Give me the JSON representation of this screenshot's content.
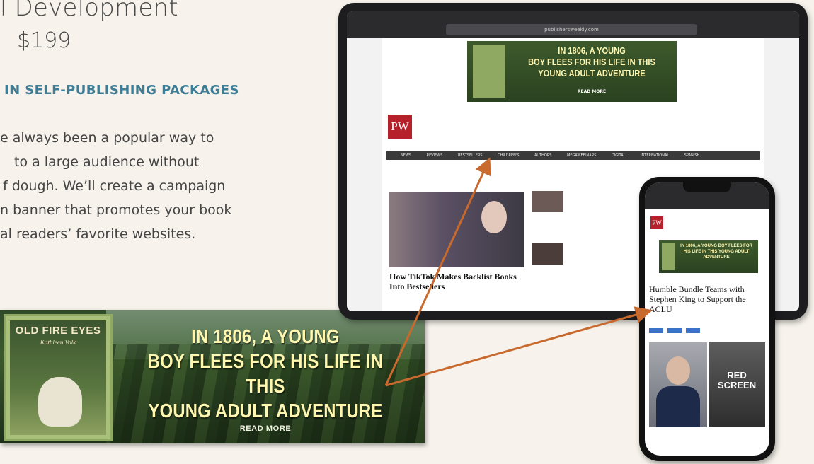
{
  "hero": {
    "title": "l Development",
    "price": "$199",
    "subhead": "IN SELF-PUBLISHING PACKAGES",
    "body_lines": [
      "e always been a popular way to",
      "to a large audience without",
      "f dough. We’ll create a campaign",
      "n banner that promotes your book",
      "al readers’ favorite websites."
    ]
  },
  "banner": {
    "book_title": "OLD FIRE EYES",
    "book_author": "Kathleen Volk",
    "headline_lines": [
      "IN 1806, A YOUNG",
      "BOY FLEES FOR HIS LIFE IN THIS",
      "YOUNG ADULT ADVENTURE"
    ],
    "cta": "READ MORE"
  },
  "tablet": {
    "url": "publishersweekly.com",
    "ad_lines": [
      "IN 1806, A YOUNG",
      "BOY FLEES FOR HIS LIFE IN THIS",
      "YOUNG ADULT ADVENTURE"
    ],
    "ad_cta": "READ MORE",
    "logo": "PW",
    "nav": "NEWS REVIEWS BESTSELLERS CHILDREN'S AUTHORS MEGAWEBINARS DIGITAL INTERNATIONAL SPANISH",
    "article_title": "How TikTok Makes Backlist Books Into Bestsellers"
  },
  "phone": {
    "logo": "PW",
    "ad_text": "IN 1806, A YOUNG BOY FLEES FOR HIS LIFE IN THIS YOUNG ADULT ADVENTURE",
    "article_title": "Humble Bundle Teams with Stephen King to Support the ACLU",
    "photo_text": "RED SCREEN"
  },
  "colors": {
    "background": "#f7f3ec",
    "accent": "#3d7d96",
    "arrow": "#c8692e",
    "pw_red": "#b5202a"
  }
}
